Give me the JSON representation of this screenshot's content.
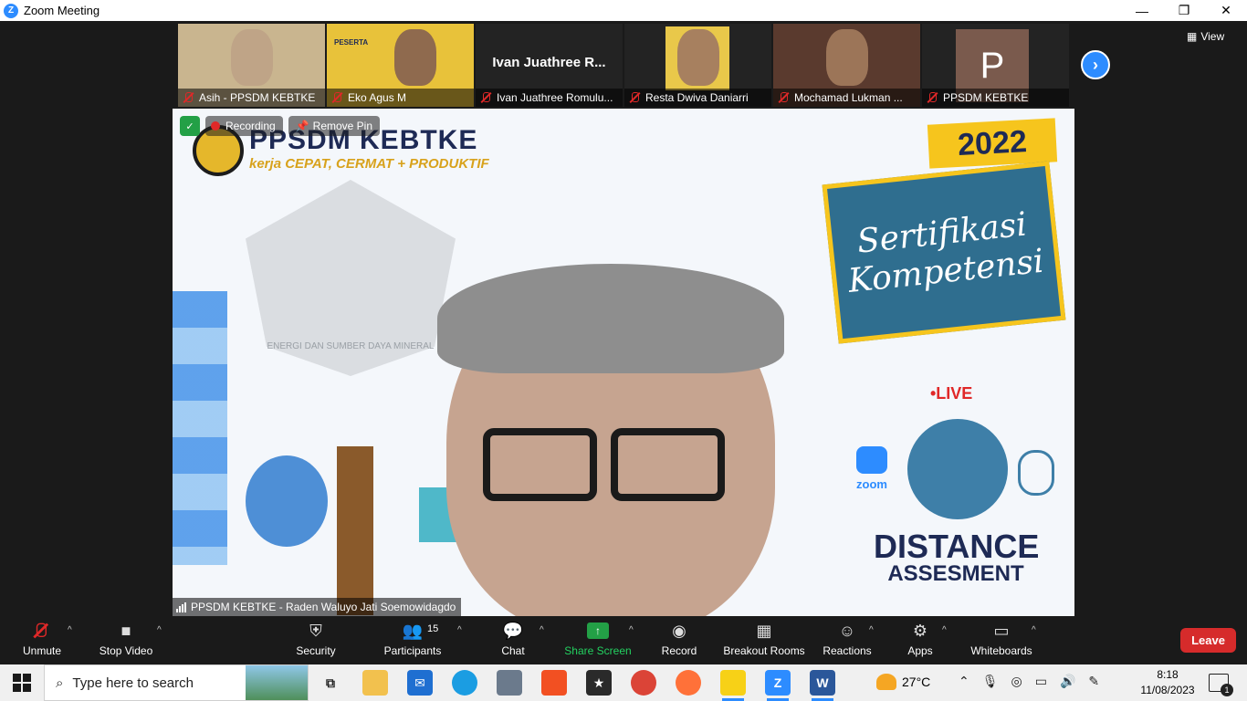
{
  "window": {
    "title": "Zoom Meeting",
    "minimize": "—",
    "restore": "❐",
    "close": "✕"
  },
  "gallery": {
    "tiles": [
      {
        "name": "Asih - PPSDM KEBTKE",
        "type": "video",
        "bg": "#c9b58f",
        "face": "#bfa487"
      },
      {
        "name": "Eko Agus M",
        "type": "video",
        "bg": "#e8c23a",
        "face": "#8f6a4e",
        "overlay_title": "PESERTA"
      },
      {
        "name": "Ivan Juathree Romulu...",
        "type": "name",
        "big": "Ivan Juathree R..."
      },
      {
        "name": "Resta Dwiva Daniarri",
        "type": "video",
        "bg": "#232323",
        "face": "#a7805f"
      },
      {
        "name": "Mochamad Lukman ...",
        "type": "video",
        "bg": "#5a3a2e",
        "face": "#9c7558"
      },
      {
        "name": "PPSDM KEBTKE",
        "type": "avatar",
        "letter": "P"
      }
    ],
    "next_icon": "›",
    "view_label": "View"
  },
  "main_video": {
    "recording_label": "Recording",
    "remove_pin_label": "Remove Pin",
    "speaker_name": "PPSDM KEBTKE - Raden Waluyo Jati Soemowidagdo",
    "slide": {
      "org": "PPSDM KEBTKE",
      "tagline": "kerja CEPAT, CERMAT + PRODUKTIF",
      "emblem_text": "ENERGI DAN SUMBER DAYA MINERAL",
      "year": "2022",
      "cert_line1": "Sertifikasi",
      "cert_line2": "Kompetensi",
      "live": "•LIVE",
      "zoom": "zoom",
      "distance": "DISTANCE",
      "assesment": "ASSESMENT"
    }
  },
  "toolbar": {
    "unmute": "Unmute",
    "stop_video": "Stop Video",
    "security": "Security",
    "participants": "Participants",
    "participants_count": "15",
    "chat": "Chat",
    "share_screen": "Share Screen",
    "record": "Record",
    "breakout": "Breakout Rooms",
    "reactions": "Reactions",
    "apps": "Apps",
    "whiteboards": "Whiteboards",
    "leave": "Leave"
  },
  "taskbar": {
    "search_placeholder": "Type here to search",
    "temperature": "27°C",
    "time": "8:18",
    "date": "11/08/2023",
    "notification_count": "1"
  },
  "colors": {
    "zoom_blue": "#2d8cff",
    "leave_red": "#d62b2b",
    "share_green": "#23a046",
    "muted_red": "#e02828"
  }
}
